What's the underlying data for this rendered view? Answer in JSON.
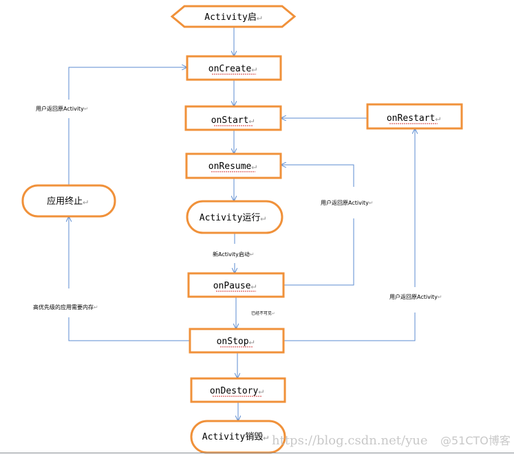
{
  "colors": {
    "box_border": "#f0913a",
    "arrow": "#5b8bd0",
    "squiggle": "#d03030"
  },
  "nodes": {
    "start": "Activity启",
    "onCreate": "onCreate",
    "onStart": "onStart",
    "onRestart": "onRestart",
    "onResume": "onResume",
    "running": "Activity运行",
    "killed": "应用终止",
    "onPause": "onPause",
    "onStop": "onStop",
    "onDestroy": "onDestory",
    "destroyed": "Activity销毁"
  },
  "edge_labels": {
    "return_left": "用户返回原Activity",
    "return_middle": "用户返回原Activity",
    "return_right": "用户返回原Activity",
    "new_activity": "新Activity启动",
    "high_priority": "高优先级的应用需要内存",
    "invisible": "已经不可见"
  },
  "paragraph_mark": "↵",
  "watermark": {
    "url": "https://blog.csdn.net/yue",
    "site": "@51CTO博客"
  }
}
